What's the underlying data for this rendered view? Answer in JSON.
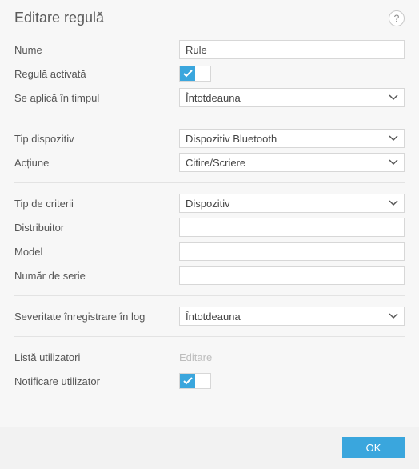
{
  "header": {
    "title": "Editare regulă",
    "help_tooltip": "?"
  },
  "fields": {
    "name_label": "Nume",
    "name_value": "Rule",
    "enabled_label": "Regulă activată",
    "enabled_value": true,
    "applies_label": "Se aplică în timpul",
    "applies_value": "Întotdeauna",
    "device_type_label": "Tip dispozitiv",
    "device_type_value": "Dispozitiv Bluetooth",
    "action_label": "Acțiune",
    "action_value": "Citire/Scriere",
    "criteria_type_label": "Tip de criterii",
    "criteria_type_value": "Dispozitiv",
    "vendor_label": "Distribuitor",
    "vendor_value": "",
    "model_label": "Model",
    "model_value": "",
    "serial_label": "Număr de serie",
    "serial_value": "",
    "log_severity_label": "Severitate înregistrare în log",
    "log_severity_value": "Întotdeauna",
    "user_list_label": "Listă utilizatori",
    "user_list_action": "Editare",
    "notify_user_label": "Notificare utilizator",
    "notify_user_value": true
  },
  "footer": {
    "ok_label": "OK"
  }
}
